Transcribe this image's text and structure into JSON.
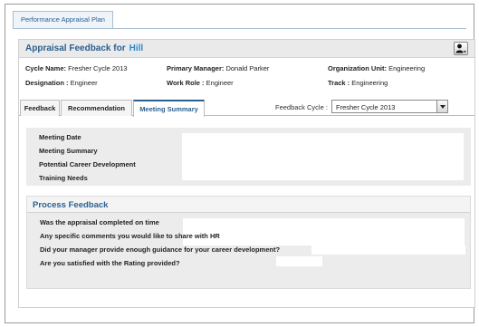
{
  "page_tab": "Performance Appraisal Plan",
  "header": {
    "title_prefix": "Appraisal Feedback for",
    "employee_name": "Hill"
  },
  "info": {
    "cycle_label": "Cycle Name:",
    "cycle_value": "Fresher Cycle 2013",
    "manager_label": "Primary Manager:",
    "manager_value": "Donald Parker",
    "org_label": "Organization Unit:",
    "org_value": "Engineering",
    "designation_label": "Designation :",
    "designation_value": "Engineer",
    "role_label": "Work Role :",
    "role_value": "Engineer",
    "track_label": "Track :",
    "track_value": "Engineering"
  },
  "tabs": [
    "Feedback",
    "Recommendation",
    "Meeting Summary"
  ],
  "feedback_cycle": {
    "label": "Feedback Cycle :",
    "value": "Fresher Cycle 2013"
  },
  "meeting_summary_fields": [
    "Meeting Date",
    "Meeting Summary",
    "Potential Career Development",
    "Training Needs"
  ],
  "process_feedback": {
    "title": "Process Feedback",
    "questions": [
      "Was the appraisal completed on time",
      "Any specific comments you would like to share with HR",
      "Did your manager provide enough guidance for your career development?",
      "Are you satisfied with the Rating provided?"
    ]
  },
  "colors": {
    "accent": "#2a5f8f",
    "name": "#2b8ad0",
    "panel_gray": "#ececec"
  },
  "icons": {
    "user_button": "user-menu-icon",
    "dropdown": "chevron-down-icon"
  }
}
